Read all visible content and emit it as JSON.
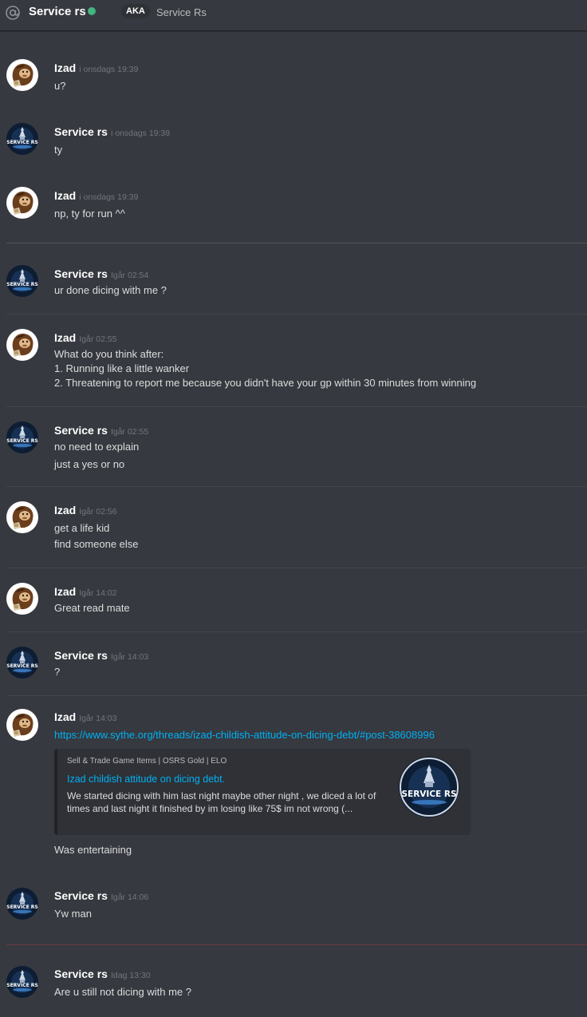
{
  "header": {
    "channel_name": "Service rs",
    "aka_label": "AKA",
    "aka_name": "Service Rs",
    "status_color": "#43b581",
    "icon": "at-sign-icon"
  },
  "messages": [
    {
      "author": "Izad",
      "timestamp": "i onsdags 19:39",
      "lines": [
        "u?"
      ]
    },
    {
      "author": "Service rs",
      "timestamp": "i onsdags 19:39",
      "lines": [
        "ty"
      ]
    },
    {
      "author": "Izad",
      "timestamp": "i onsdags 19:39",
      "lines": [
        "np, ty for run ^^"
      ]
    },
    {
      "author": "Service rs",
      "timestamp": "Igår 02:54",
      "lines": [
        "ur done dicing with me ?"
      ]
    },
    {
      "author": "Izad",
      "timestamp": "Igår 02:55",
      "lines": [
        "What do you think after:",
        "1. Running like a little wanker",
        "2. Threatening to report me because you didn't have your gp within 30 minutes from winning"
      ]
    },
    {
      "author": "Service rs",
      "timestamp": "Igår 02:55",
      "lines": [
        "no need to explain",
        "just a yes or no"
      ]
    },
    {
      "author": "Izad",
      "timestamp": "Igår 02:56",
      "lines": [
        "get a life kid",
        "find someone else"
      ]
    },
    {
      "author": "Izad",
      "timestamp": "Igår 14:02",
      "lines": [
        "Great read mate"
      ]
    },
    {
      "author": "Service rs",
      "timestamp": "Igår 14:03",
      "lines": [
        "?"
      ]
    },
    {
      "author": "Izad",
      "timestamp": "Igår 14:03",
      "link": "https://www.sythe.org/threads/izad-childish-attitude-on-dicing-debt/#post-38608996",
      "after_embed": "Was entertaining"
    },
    {
      "author": "Service rs",
      "timestamp": "Igår 14:06",
      "lines": [
        "Yw man"
      ]
    },
    {
      "author": "Service rs",
      "timestamp": "Idag 13:30",
      "lines": [
        "Are u still not dicing with me ?"
      ]
    }
  ],
  "embed": {
    "provider": "Sell & Trade Game Items | OSRS Gold | ELO",
    "title": "Izad childish attitude on dicing debt.",
    "description": "We started dicing with him last night maybe other night , we diced a lot of times and last night it finished by im losing like 75$ im not wrong (...",
    "thumbnail_text": "SERVICE RS"
  },
  "avatars": {
    "izad": "ape-avatar-icon",
    "service_rs": "service-rs-logo-icon",
    "service_rs_text": "SERVICE RS"
  },
  "colors": {
    "background": "#36393f",
    "link": "#00b0f4",
    "new_messages_divider": "#6b3b40"
  }
}
